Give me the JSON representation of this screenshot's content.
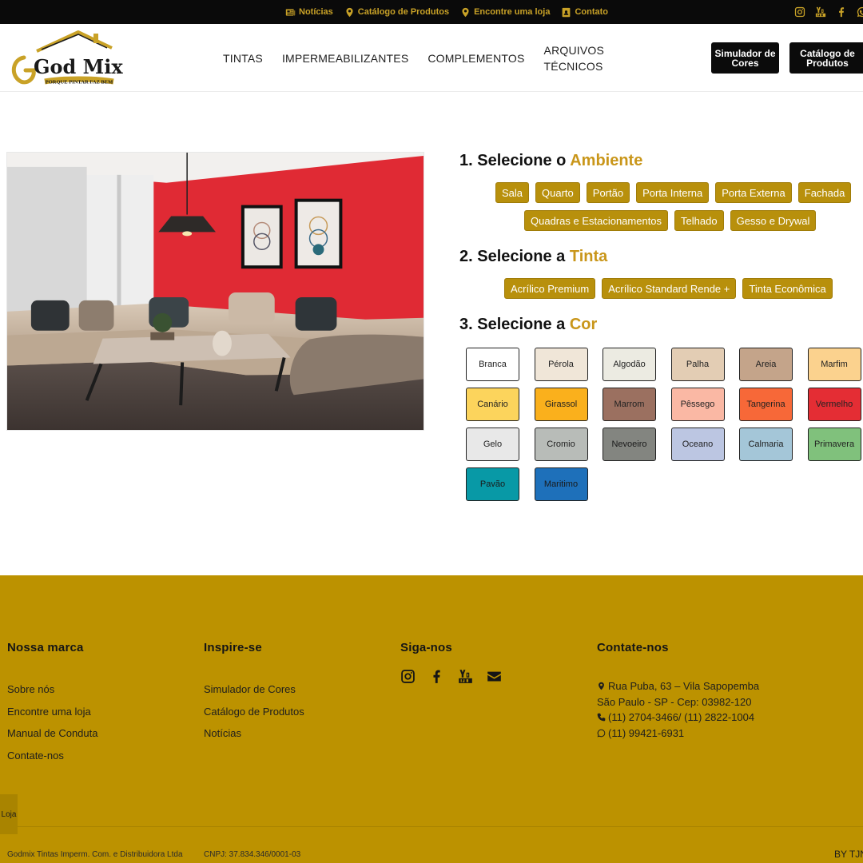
{
  "topbar": {
    "links": [
      {
        "label": "Notícias",
        "icon": "newspaper-icon"
      },
      {
        "label": "Catálogo de Produtos",
        "icon": "map-marker-icon"
      },
      {
        "label": "Encontre uma loja",
        "icon": "map-marker-icon"
      },
      {
        "label": "Contato",
        "icon": "contact-card-icon"
      }
    ],
    "social": [
      "instagram-icon",
      "youtube-icon",
      "facebook-icon",
      "whatsapp-icon"
    ],
    "accent": "#c9a227"
  },
  "header": {
    "logo_text": "God Mix",
    "logo_tagline": "PORQUE PINTAR FAZ BEM",
    "nav": [
      "TINTAS",
      "IMPERMEABILIZANTES",
      "COMPLEMENTOS",
      "ARQUIVOS TÉCNICOS"
    ],
    "btn_simulador": "Simulador de Cores",
    "btn_catalogo": "Catálogo de Produtos"
  },
  "steps": {
    "ambiente": {
      "prefix": "1. Selecione o",
      "highlight": "Ambiente",
      "options_row1": [
        "Sala",
        "Quarto",
        "Portão",
        "Porta Interna",
        "Porta Externa",
        "Fachada"
      ],
      "options_row2": [
        "Quadras e Estacionamentos",
        "Telhado",
        "Gesso e Drywal"
      ]
    },
    "tinta": {
      "prefix": "2. Selecione a",
      "highlight": "Tinta",
      "options": [
        "Acrílico Premium",
        "Acrílico Standard Rende +",
        "Tinta Econômica"
      ]
    },
    "cor": {
      "prefix": "3. Selecione a",
      "highlight": "Cor",
      "colors": [
        {
          "name": "Branca",
          "hex": "#ffffff"
        },
        {
          "name": "Pérola",
          "hex": "#f0e6d8"
        },
        {
          "name": "Algodão",
          "hex": "#ecebe2"
        },
        {
          "name": "Palha",
          "hex": "#e3cdb4"
        },
        {
          "name": "Areia",
          "hex": "#c4a48a"
        },
        {
          "name": "Marfim",
          "hex": "#fbd28e"
        },
        {
          "name": "Canário",
          "hex": "#fcd45c"
        },
        {
          "name": "Girassol",
          "hex": "#fab01c"
        },
        {
          "name": "Marrom",
          "hex": "#9b7060"
        },
        {
          "name": "Pêssego",
          "hex": "#fab8a4"
        },
        {
          "name": "Tangerina",
          "hex": "#f76838"
        },
        {
          "name": "Vermelho",
          "hex": "#e42d34"
        },
        {
          "name": "Gelo",
          "hex": "#e8e8e8"
        },
        {
          "name": "Cromio",
          "hex": "#b8bcb8"
        },
        {
          "name": "Nevoeiro",
          "hex": "#838580"
        },
        {
          "name": "Oceano",
          "hex": "#bcc6e2"
        },
        {
          "name": "Calmaria",
          "hex": "#a4c6d8"
        },
        {
          "name": "Primavera",
          "hex": "#80c17c"
        },
        {
          "name": "Pavão",
          "hex": "#0899a6"
        },
        {
          "name": "Maritimo",
          "hex": "#1e70ba"
        }
      ]
    }
  },
  "room": {
    "wall_color": "#e02a34"
  },
  "footer": {
    "marca_title": "Nossa marca",
    "marca_links": [
      "Sobre nós",
      "Encontre uma loja",
      "Manual de Conduta",
      "Contate-nos"
    ],
    "inspire_title": "Inspire-se",
    "inspire_links": [
      "Simulador de Cores",
      "Catálogo de Produtos",
      "Notícias"
    ],
    "siga_title": "Siga-nos",
    "siga_icons": [
      "instagram-icon",
      "facebook-icon",
      "youtube-icon",
      "envelope-icon"
    ],
    "contate_title": "Contate-nos",
    "address1": "Rua Puba, 63 – Vila Sapopemba",
    "address2": "São Paulo - SP - Cep: 03982-120",
    "phones": "(11) 2704-3466/ (11) 2822-1004",
    "whatsapp": "(11) 99421-6931",
    "loja_tab": "Loja",
    "company": "Godmix Tintas Imperm. Com. e Distribuidora Ltda",
    "cnpj": "CNPJ: 37.834.346/0001-03",
    "by": "BY TJN",
    "bg": "#bc9200"
  }
}
